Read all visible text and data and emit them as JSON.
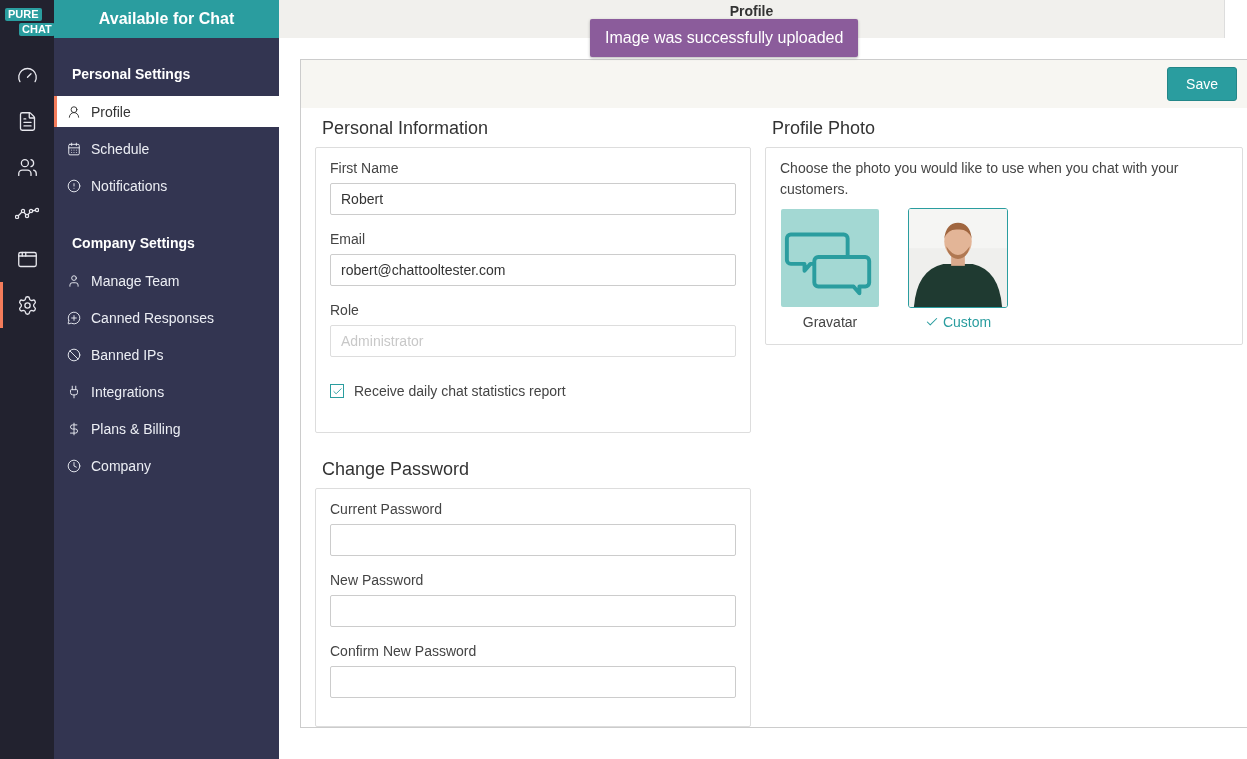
{
  "logo": {
    "top": "PURE",
    "bottom": "CHAT"
  },
  "rail_items": [
    {
      "kind": "dashboard",
      "selected": false
    },
    {
      "kind": "transcripts",
      "selected": false
    },
    {
      "kind": "contacts",
      "selected": false
    },
    {
      "kind": "analytics",
      "selected": false
    },
    {
      "kind": "widgets",
      "selected": false
    },
    {
      "kind": "settings",
      "selected": true
    }
  ],
  "status": "Available for Chat",
  "sidebar": {
    "sections": [
      {
        "title": "Personal Settings",
        "items": [
          {
            "kind": "profile",
            "label": "Profile",
            "selected": true
          },
          {
            "kind": "schedule",
            "label": "Schedule",
            "selected": false
          },
          {
            "kind": "notifications",
            "label": "Notifications",
            "selected": false
          }
        ]
      },
      {
        "title": "Company Settings",
        "items": [
          {
            "kind": "team",
            "label": "Manage Team",
            "selected": false
          },
          {
            "kind": "canned",
            "label": "Canned Responses",
            "selected": false
          },
          {
            "kind": "banned",
            "label": "Banned IPs",
            "selected": false
          },
          {
            "kind": "integrations",
            "label": "Integrations",
            "selected": false
          },
          {
            "kind": "billing",
            "label": "Plans & Billing",
            "selected": false
          },
          {
            "kind": "company",
            "label": "Company",
            "selected": false
          }
        ]
      }
    ]
  },
  "header": {
    "title": "Profile"
  },
  "toast": "Image was successfully uploaded",
  "save_button": "Save",
  "personal": {
    "title": "Personal Information",
    "fields": [
      {
        "label": "First Name",
        "value": "Robert",
        "disabled": false
      },
      {
        "label": "Email",
        "value": "robert@chattooltester.com",
        "disabled": false
      },
      {
        "label": "Role",
        "placeholder": "Administrator",
        "disabled": true
      }
    ],
    "checkbox": {
      "label": "Receive daily chat statistics report",
      "checked": true
    }
  },
  "password": {
    "title": "Change Password",
    "fields": [
      {
        "label": "Current Password",
        "disabled": false
      },
      {
        "label": "New Password",
        "disabled": false
      },
      {
        "label": "Confirm New Password",
        "disabled": false
      }
    ]
  },
  "photo": {
    "title": "Profile Photo",
    "text": "Choose the photo you would like to use when you chat with your customers.",
    "options": [
      {
        "kind": "gravatar",
        "label": "Gravatar",
        "selected": false
      },
      {
        "kind": "custom",
        "label": "Custom",
        "selected": true
      }
    ]
  }
}
